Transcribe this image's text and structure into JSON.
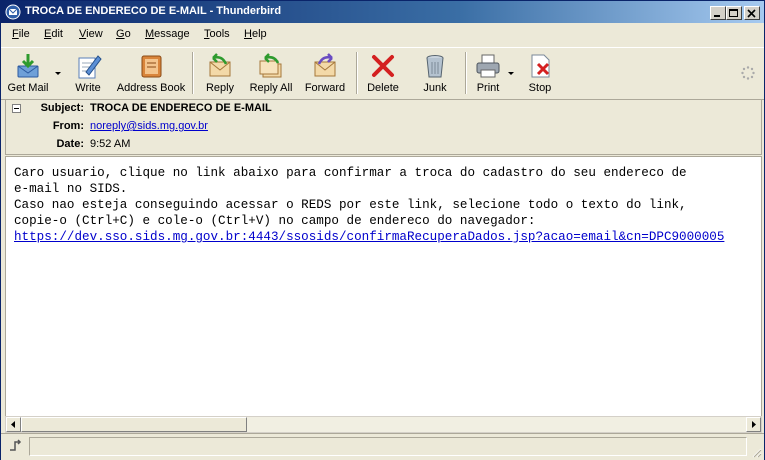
{
  "window": {
    "title": "TROCA DE ENDERECO DE E-MAIL - Thunderbird"
  },
  "menu": {
    "items": [
      {
        "accel": "F",
        "rest": "ile"
      },
      {
        "accel": "E",
        "rest": "dit"
      },
      {
        "accel": "V",
        "rest": "iew"
      },
      {
        "accel": "G",
        "rest": "o"
      },
      {
        "accel": "M",
        "rest": "essage"
      },
      {
        "accel": "T",
        "rest": "ools"
      },
      {
        "accel": "H",
        "rest": "elp"
      }
    ]
  },
  "toolbar": {
    "get_mail": "Get Mail",
    "write": "Write",
    "address_book": "Address Book",
    "reply": "Reply",
    "reply_all": "Reply All",
    "forward": "Forward",
    "delete": "Delete",
    "junk": "Junk",
    "print": "Print",
    "stop": "Stop"
  },
  "header": {
    "subject_label": "Subject:",
    "subject": "TROCA DE ENDERECO DE E-MAIL",
    "from_label": "From:",
    "from": "noreply@sids.mg.gov.br",
    "date_label": "Date:",
    "date": "9:52 AM"
  },
  "body": {
    "line1": "Caro usuario, clique no link abaixo para confirmar a troca do cadastro do seu endereco de",
    "line2": "e-mail no SIDS.",
    "line3": "Caso nao esteja conseguindo acessar o REDS por este link, selecione todo o texto do link,",
    "line4": "copie-o (Ctrl+C) e cole-o (Ctrl+V) no campo de endereco do navegador:",
    "link": "https://dev.sso.sids.mg.gov.br:4443/ssosids/confirmaRecuperaDados.jsp?acao=email&cn=DPC9000005"
  },
  "colors": {
    "titlebar_start": "#0a246a",
    "titlebar_end": "#a6caf0",
    "link": "#0000cc",
    "chrome": "#ece9d8"
  }
}
